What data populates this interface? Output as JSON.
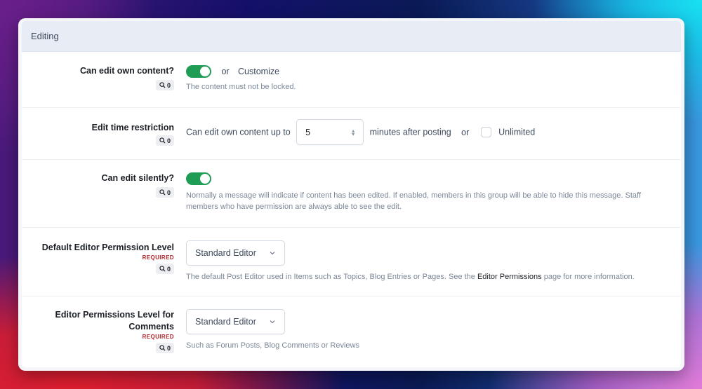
{
  "section": {
    "title": "Editing"
  },
  "rows": [
    {
      "label": "Can edit own content?",
      "search_count": "0",
      "toggle_on": true,
      "or_text": "or",
      "customize_label": "Customize",
      "description": "The content must not be locked."
    },
    {
      "label": "Edit time restriction",
      "search_count": "0",
      "prefix": "Can edit own content up to",
      "value": "5",
      "suffix": "minutes after posting",
      "or_text": "or",
      "unlimited_label": "Unlimited",
      "unlimited_checked": false
    },
    {
      "label": "Can edit silently?",
      "search_count": "0",
      "toggle_on": true,
      "description": "Normally a message will indicate if content has been edited. If enabled, members in this group will be able to hide this message. Staff members who have permission are always able to see the edit."
    },
    {
      "label": "Default Editor Permission Level",
      "required": "REQUIRED",
      "search_count": "0",
      "selected": "Standard Editor",
      "description_before": "The default Post Editor used in Items such as Topics, Blog Entries or Pages. See the ",
      "description_link": "Editor Permissions",
      "description_after": " page for more information."
    },
    {
      "label": "Editor Permissions Level for Comments",
      "required": "REQUIRED",
      "search_count": "0",
      "selected": "Standard Editor",
      "description": "Such as Forum Posts, Blog Comments or Reviews"
    }
  ],
  "colors": {
    "toggle_on": "#1f9d55",
    "required": "#b3262c",
    "header_bg": "#e8edf5"
  }
}
